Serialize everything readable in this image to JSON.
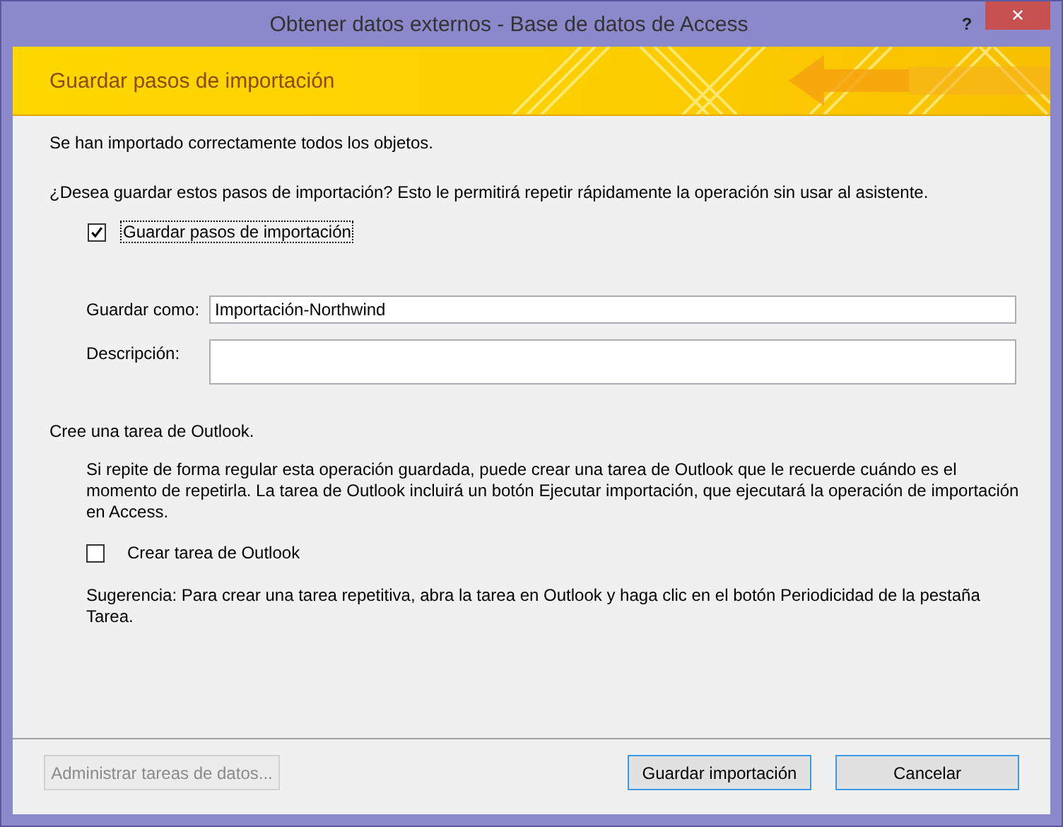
{
  "window": {
    "title": "Obtener datos externos - Base de datos de Access",
    "help": "?",
    "close": "✕"
  },
  "banner": {
    "title": "Guardar pasos de importación"
  },
  "status_message": "Se han importado correctamente todos los objetos.",
  "question": "¿Desea guardar estos pasos de importación? Esto le permitirá repetir rápidamente la operación sin usar al asistente.",
  "save_steps": {
    "label": "Guardar pasos de importación",
    "checked": true,
    "focused": true
  },
  "fields": [
    {
      "label": "Guardar como:",
      "value": "Importación-Northwind",
      "kind": "single"
    },
    {
      "label": "Descripción:",
      "kind": "multi"
    }
  ],
  "outlook": {
    "heading": "Cree una tarea de Outlook.",
    "description": "Si repite de forma regular esta operación guardada, puede crear una tarea de Outlook que le recuerde cuándo es el momento de repetirla. La tarea de Outlook incluirá un botón Ejecutar importación, que ejecutará la operación de importación en Access.",
    "checkbox": {
      "label": "Crear tarea de Outlook",
      "checked": false,
      "focused": false
    },
    "hint": "Sugerencia: Para crear una tarea repetitiva, abra la tarea en Outlook y haga clic en el botón Periodicidad de la pestaña Tarea."
  },
  "buttons": [
    {
      "label": "Administrar tareas de datos...",
      "disabled": true,
      "highlighted": false
    },
    {
      "label": "Guardar importación",
      "disabled": false,
      "highlighted": true
    },
    {
      "label": "Cancelar",
      "disabled": false,
      "highlighted": true
    }
  ]
}
